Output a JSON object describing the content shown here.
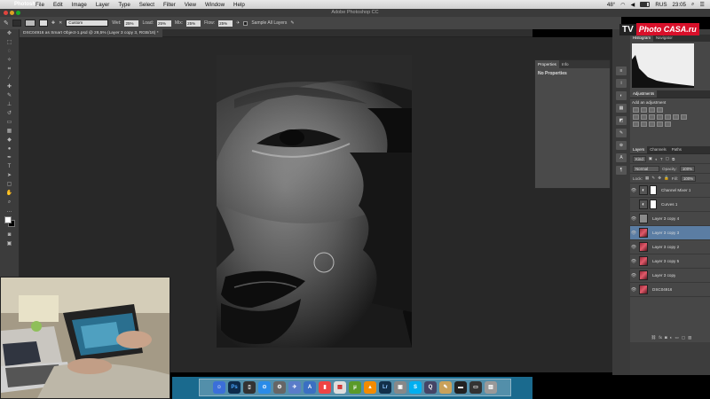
{
  "menubar": {
    "app": "Photoshop",
    "items": [
      "File",
      "Edit",
      "Image",
      "Layer",
      "Type",
      "Select",
      "Filter",
      "View",
      "Window",
      "Help"
    ],
    "clock": "23:05",
    "lang": "RUS",
    "temp": "48°"
  },
  "window": {
    "title": "Adobe Photoshop CC"
  },
  "options": {
    "mode": "Custom",
    "wet_label": "Wet:",
    "wet": "25%",
    "load_label": "Load:",
    "load": "25%",
    "mix_label": "Mix:",
    "mix": "25%",
    "flow_label": "Flow:",
    "flow": "25%",
    "sample_all": "Sample All Layers"
  },
  "document": {
    "tab": "DSC04916 as Smart Object-1.psd @ 28,5% (Layer 3 copy 3, RGB/16) *"
  },
  "properties": {
    "tabs": [
      "Properties",
      "Info"
    ],
    "message": "No Properties"
  },
  "histogram": {
    "tabs": [
      "Histogram",
      "Navigator"
    ]
  },
  "adjustments": {
    "tabs": [
      "Adjustments"
    ],
    "title": "Add an adjustment"
  },
  "layers": {
    "tabs": [
      "Layers",
      "Channels",
      "Paths"
    ],
    "kind": "Kind",
    "blend": "Normal",
    "opacity_label": "Opacity:",
    "opacity": "100%",
    "lock_label": "Lock:",
    "fill_label": "Fill:",
    "fill": "100%",
    "rows": [
      {
        "name": "Channel Mixer 1",
        "type": "adjustment",
        "visible": true,
        "selected": false
      },
      {
        "name": "Curves 1",
        "type": "adjustment",
        "visible": false,
        "selected": false
      },
      {
        "name": "Layer 3 copy 4",
        "type": "gray",
        "visible": true,
        "selected": false
      },
      {
        "name": "Layer 3 copy 3",
        "type": "photo",
        "visible": true,
        "selected": true
      },
      {
        "name": "Layer 3 copy 2",
        "type": "photo",
        "visible": true,
        "selected": false
      },
      {
        "name": "Layer 3 copy 5",
        "type": "photo",
        "visible": true,
        "selected": false
      },
      {
        "name": "Layer 3 copy",
        "type": "photo",
        "visible": true,
        "selected": false
      },
      {
        "name": "DSC04916",
        "type": "photo",
        "visible": true,
        "selected": false
      }
    ]
  },
  "logo": {
    "tv": "TV",
    "brand": "Photo CASA.ru"
  },
  "colors": {
    "accent": "#5b7da3",
    "brand_red": "#d8102a"
  }
}
